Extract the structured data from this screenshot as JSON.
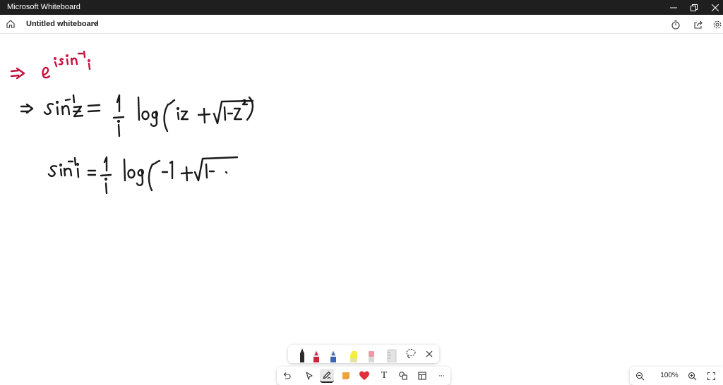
{
  "window": {
    "title": "Microsoft Whiteboard",
    "controls": [
      "minimize-icon",
      "restore-icon",
      "close-icon"
    ]
  },
  "header": {
    "board_title": "Untitled whiteboard",
    "left_icons": [
      "home-icon",
      "chevron-down-icon"
    ],
    "right_icons": [
      "timer-icon",
      "share-icon",
      "settings-icon"
    ]
  },
  "canvas": {
    "background": "#ffffff",
    "ink_colors": {
      "red": "#c8103c",
      "black": "#1a1a1a"
    },
    "handwritten_lines": [
      "⇒ e^(i sin⁻¹ i)",
      "⇒ sin⁻¹z = (1/i) log ( iz + √(1−z²) )",
      "sin⁻¹ i = (1/i) log ( −1 + √(1−"
    ]
  },
  "pen_palette": {
    "pens": [
      {
        "name": "black-pen",
        "color": "#1a1a1a",
        "selected": true
      },
      {
        "name": "red-pen",
        "color": "#d0233b",
        "selected": false
      },
      {
        "name": "blue-pen",
        "color": "#3a66b5",
        "selected": false
      },
      {
        "name": "yellow-highlighter",
        "color": "#f4ee3c",
        "selected": false
      },
      {
        "name": "pink-eraser",
        "color": "#ea9aa6",
        "selected": false
      },
      {
        "name": "ruler",
        "color": "#bdbdbd",
        "selected": false
      }
    ],
    "extra_icons": [
      "lasso-icon",
      "close-icon"
    ]
  },
  "toolbar": {
    "tools": [
      "undo-icon",
      "select-icon",
      "pen-icon",
      "sticky-note-icon",
      "reaction-icon",
      "text-icon",
      "shapes-icon",
      "templates-icon",
      "more-icon"
    ],
    "active": "pen-icon",
    "text_glyph": "T",
    "more_glyph": "···",
    "accent_orange": "#f0a23a",
    "accent_red": "#e0303c"
  },
  "zoom": {
    "level": "100%",
    "icons": [
      "zoom-out-icon",
      "zoom-in-icon",
      "fit-icon"
    ]
  }
}
